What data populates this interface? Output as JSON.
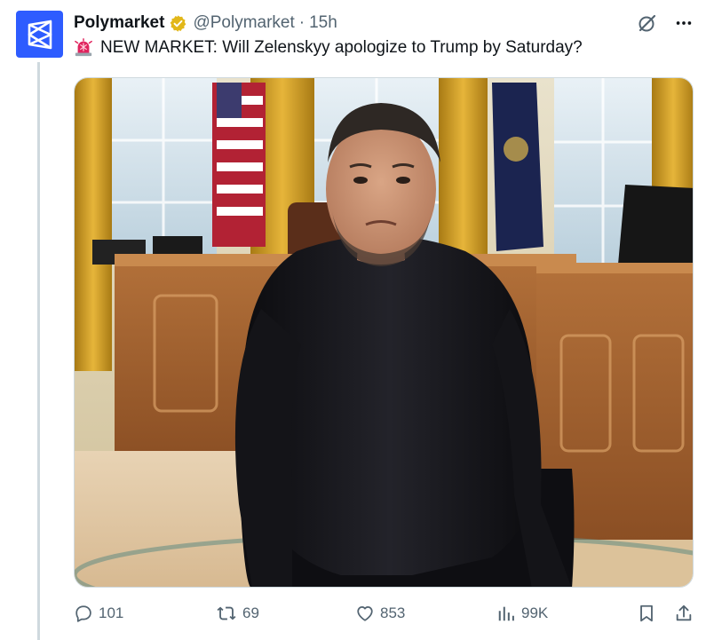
{
  "author": {
    "name": "Polymarket",
    "handle": "@Polymarket",
    "separator": "·",
    "time": "15h",
    "verified_color": "#e2b719",
    "avatar_color": "#2e5cff"
  },
  "post": {
    "siren_icon": "rotating-light-emoji",
    "text": "NEW MARKET: Will Zelenskyy apologize to Trump by Saturday?"
  },
  "media": {
    "alt_description": "Oval Office photo with a man in a black sweater kneeling"
  },
  "actions": {
    "replies": "101",
    "reposts": "69",
    "likes": "853",
    "views": "99K"
  },
  "colors": {
    "text": "#0f1419",
    "muted": "#536471",
    "thread_line": "#cfd9de"
  }
}
